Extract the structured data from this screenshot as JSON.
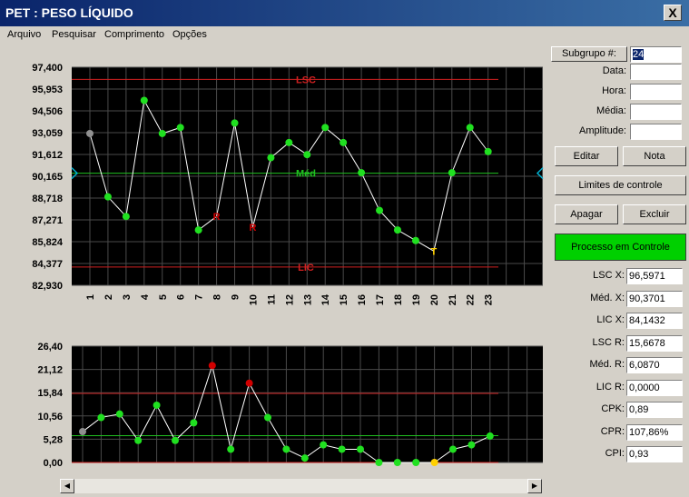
{
  "window": {
    "title": "PET : PESO LÍQUIDO",
    "close_label": "X"
  },
  "menu": [
    "Arquivo",
    "Pesquisar",
    "Comprimento",
    "Opções"
  ],
  "panel": {
    "subgroup_button": "Subgrupo #:",
    "subgroup_value": "24",
    "data_label": "Data:",
    "hora_label": "Hora:",
    "media_label": "Média:",
    "amplitude_label": "Amplitude:",
    "editar": "Editar",
    "nota": "Nota",
    "limites": "Limites de controle",
    "apagar": "Apagar",
    "excluir": "Excluir",
    "status": "Processo em Controle",
    "stats": [
      {
        "label": "LSC X:",
        "value": "96,5971"
      },
      {
        "label": "Méd. X:",
        "value": "90,3701"
      },
      {
        "label": "LIC X:",
        "value": "84,1432"
      },
      {
        "label": "LSC R:",
        "value": "15,6678"
      },
      {
        "label": "Méd. R:",
        "value": "6,0870"
      },
      {
        "label": "LIC R:",
        "value": "0,0000"
      },
      {
        "label": "CPK:",
        "value": "0,89"
      },
      {
        "label": "CPR:",
        "value": "107,86%"
      },
      {
        "label": "CPI:",
        "value": "0,93"
      }
    ]
  },
  "colors": {
    "plot_bg": "#000000",
    "grid": "#4a4a4a",
    "limit": "#d02020",
    "center": "#20c020",
    "ok_point": "#20e020",
    "first_point": "#909090",
    "alarm_point": "#d00000",
    "yellow_point": "#ffd000"
  },
  "chart_data": [
    {
      "type": "line",
      "title": "",
      "yticks": [
        "97,400",
        "95,953",
        "94,506",
        "93,059",
        "91,612",
        "90,165",
        "88,718",
        "87,271",
        "85,824",
        "84,377",
        "82,930"
      ],
      "ylim": [
        82.93,
        97.4
      ],
      "x": [
        1,
        2,
        3,
        4,
        5,
        6,
        7,
        8,
        9,
        10,
        11,
        12,
        13,
        14,
        15,
        16,
        17,
        18,
        19,
        20,
        21,
        22,
        23
      ],
      "values": [
        93.0,
        88.8,
        87.5,
        95.2,
        93.0,
        93.4,
        86.6,
        87.5,
        93.7,
        86.8,
        91.4,
        92.4,
        91.6,
        93.4,
        92.4,
        90.4,
        87.9,
        86.6,
        85.9,
        85.2,
        90.4,
        93.4,
        91.8
      ],
      "point_status": [
        "first",
        "ok",
        "ok",
        "ok",
        "ok",
        "ok",
        "ok",
        "alarm",
        "ok",
        "alarm",
        "ok",
        "ok",
        "ok",
        "ok",
        "ok",
        "ok",
        "ok",
        "ok",
        "ok",
        "warn",
        "ok",
        "ok",
        "ok"
      ],
      "alarm_label": "R",
      "warn_label": "T",
      "lines": [
        {
          "name": "LSC",
          "value": 96.5971
        },
        {
          "name": "Méd",
          "value": 90.3701
        },
        {
          "name": "LIC",
          "value": 84.1432
        }
      ]
    },
    {
      "type": "line",
      "title": "",
      "yticks": [
        "26,40",
        "21,12",
        "15,84",
        "10,56",
        "5,28",
        "0,00"
      ],
      "ylim": [
        0,
        26.4
      ],
      "x": [
        1,
        2,
        3,
        4,
        5,
        6,
        7,
        8,
        9,
        10,
        11,
        12,
        13,
        14,
        15,
        16,
        17,
        18,
        19,
        20,
        21,
        22,
        23
      ],
      "values": [
        7.0,
        10.2,
        11.0,
        5.0,
        13.0,
        5.0,
        9.0,
        22.0,
        3.0,
        18.0,
        10.2,
        3.0,
        1.0,
        4.0,
        3.0,
        3.0,
        0.0,
        0.0,
        0.0,
        0.0,
        3.0,
        4.0,
        6.0
      ],
      "point_status": [
        "first",
        "ok",
        "ok",
        "ok",
        "ok",
        "ok",
        "ok",
        "alarm",
        "ok",
        "alarm",
        "ok",
        "ok",
        "ok",
        "ok",
        "ok",
        "ok",
        "ok",
        "ok",
        "ok",
        "warn",
        "ok",
        "ok",
        "ok"
      ],
      "lines": [
        {
          "name": "LSC",
          "value": 15.6678
        },
        {
          "name": "Méd",
          "value": 6.087
        },
        {
          "name": "LIC",
          "value": 0.0
        }
      ]
    }
  ]
}
